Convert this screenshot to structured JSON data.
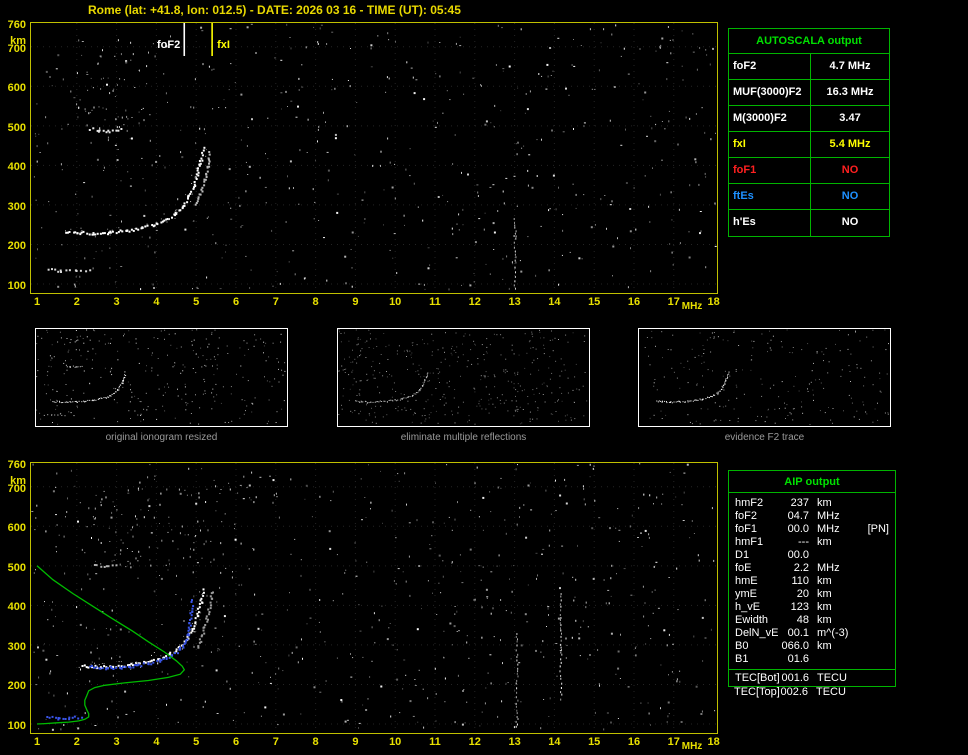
{
  "header": {
    "title": "Rome (lat: +41.8, lon: 012.5) - DATE: 2026 03 16 - TIME (UT): 05:45"
  },
  "autoscala": {
    "title": "AUTOSCALA output",
    "rows": [
      {
        "label": "foF2",
        "value": "4.7 MHz",
        "color": "#ffffff"
      },
      {
        "label": "MUF(3000)F2",
        "value": "16.3 MHz",
        "color": "#ffffff"
      },
      {
        "label": "M(3000)F2",
        "value": "3.47",
        "color": "#ffffff"
      },
      {
        "label": "fxI",
        "value": "5.4 MHz",
        "color": "#ffff00"
      },
      {
        "label": "foF1",
        "value": "NO",
        "color": "#ff2020"
      },
      {
        "label": "ftEs",
        "value": "NO",
        "color": "#1e90ff"
      },
      {
        "label": "h'Es",
        "value": "NO",
        "color": "#ffffff"
      }
    ]
  },
  "thumbnails": [
    {
      "caption": "original ionogram resized"
    },
    {
      "caption": "eliminate multiple reflections"
    },
    {
      "caption": "evidence F2 trace"
    }
  ],
  "aip": {
    "title": "AIP output",
    "rows": [
      {
        "label": "hmF2",
        "value": "237",
        "unit": "km",
        "extra": ""
      },
      {
        "label": "foF2",
        "value": "04.7",
        "unit": "MHz",
        "extra": ""
      },
      {
        "label": "foF1",
        "value": "00.0",
        "unit": "MHz",
        "extra": "[PN]"
      },
      {
        "label": "hmF1",
        "value": "---",
        "unit": "km",
        "extra": ""
      },
      {
        "label": "D1",
        "value": "00.0",
        "unit": "",
        "extra": ""
      },
      {
        "label": "foE",
        "value": "2.2",
        "unit": "MHz",
        "extra": ""
      },
      {
        "label": "hmE",
        "value": "110",
        "unit": "km",
        "extra": ""
      },
      {
        "label": "ymE",
        "value": "20",
        "unit": "km",
        "extra": ""
      },
      {
        "label": "h_vE",
        "value": "123",
        "unit": "km",
        "extra": ""
      },
      {
        "label": "Ewidth",
        "value": "48",
        "unit": "km",
        "extra": ""
      },
      {
        "label": "DelN_vE",
        "value": "00.1",
        "unit": "m^(-3)",
        "extra": ""
      },
      {
        "label": "B0",
        "value": "066.0",
        "unit": "km",
        "extra": ""
      },
      {
        "label": "B1",
        "value": "01.6",
        "unit": "",
        "extra": ""
      }
    ],
    "tec_rows": [
      {
        "label": "TEC[Bot]",
        "value": "001.6",
        "unit": "TECU"
      },
      {
        "label": "TEC[Top]",
        "value": "002.6",
        "unit": "TECU"
      }
    ]
  },
  "chart_data": [
    {
      "type": "scatter",
      "name": "ionogram-autoscala",
      "title": "measured ionogram with AUTOSCALA frequency markers",
      "xlabel": "MHz",
      "ylabel": "km",
      "xlim": [
        1,
        18
      ],
      "ylim": [
        60,
        760
      ],
      "x_ticks": [
        1,
        2,
        3,
        4,
        5,
        6,
        7,
        8,
        9,
        10,
        11,
        12,
        13,
        14,
        15,
        16,
        17,
        18
      ],
      "y_ticks": [
        760,
        700,
        600,
        500,
        400,
        300,
        200,
        100
      ],
      "grid": true,
      "markers": [
        {
          "label": "foF2",
          "freq_mhz": 4.7,
          "color": "#ffffff",
          "label_side": "left"
        },
        {
          "label": "fxI",
          "freq_mhz": 5.4,
          "color": "#ffff00",
          "label_side": "right"
        }
      ],
      "series": [
        {
          "name": "F2-trace",
          "color": "#ffffff",
          "halo": true,
          "points": [
            [
              1.7,
              235
            ],
            [
              2.0,
              232
            ],
            [
              2.4,
              230
            ],
            [
              2.8,
              232
            ],
            [
              3.2,
              236
            ],
            [
              3.6,
              243
            ],
            [
              3.9,
              252
            ],
            [
              4.2,
              263
            ],
            [
              4.45,
              278
            ],
            [
              4.65,
              298
            ],
            [
              4.8,
              322
            ],
            [
              4.92,
              350
            ],
            [
              5.02,
              382
            ],
            [
              5.1,
              415
            ],
            [
              5.15,
              445
            ]
          ]
        },
        {
          "name": "X-mode-trace",
          "color": "#b8b8b8",
          "points": [
            [
              4.95,
              300
            ],
            [
              5.08,
              330
            ],
            [
              5.2,
              365
            ],
            [
              5.28,
              400
            ],
            [
              5.33,
              435
            ]
          ]
        },
        {
          "name": "second-hop-echo",
          "color": "#e8e8e8",
          "size": 2,
          "step": 3,
          "points": [
            [
              2.3,
              495
            ],
            [
              2.55,
              490
            ],
            [
              2.8,
              488
            ],
            [
              3.1,
              494
            ]
          ]
        },
        {
          "name": "Es-trace",
          "color": "#d8d8d8",
          "size": 2,
          "step": 4,
          "points": [
            [
              1.25,
              138
            ],
            [
              1.6,
              134
            ],
            [
              1.95,
              136
            ],
            [
              2.3,
              135
            ]
          ]
        }
      ]
    },
    {
      "type": "scatter",
      "name": "ionogram-aip",
      "title": "ionogram with autoscaled trace and electron density profile",
      "xlabel": "MHz",
      "ylabel": "km",
      "xlim": [
        1,
        18
      ],
      "ylim": [
        60,
        760
      ],
      "x_ticks": [
        1,
        2,
        3,
        4,
        5,
        6,
        7,
        8,
        9,
        10,
        11,
        12,
        13,
        14,
        15,
        16,
        17,
        18
      ],
      "y_ticks": [
        760,
        700,
        600,
        500,
        400,
        300,
        200,
        100
      ],
      "grid": true,
      "markers": [],
      "series": [
        {
          "name": "F2-trace",
          "color": "#ffffff",
          "halo": true,
          "points": [
            [
              2.1,
              250
            ],
            [
              2.5,
              246
            ],
            [
              2.9,
              247
            ],
            [
              3.3,
              251
            ],
            [
              3.7,
              258
            ],
            [
              4.0,
              266
            ],
            [
              4.3,
              278
            ],
            [
              4.55,
              295
            ],
            [
              4.75,
              318
            ],
            [
              4.9,
              345
            ],
            [
              5.0,
              375
            ],
            [
              5.1,
              410
            ],
            [
              5.17,
              440
            ]
          ]
        },
        {
          "name": "X-mode-trace",
          "color": "#9a9a9a",
          "points": [
            [
              5.0,
              295
            ],
            [
              5.15,
              330
            ],
            [
              5.25,
              368
            ],
            [
              5.33,
              405
            ],
            [
              5.38,
              438
            ]
          ]
        },
        {
          "name": "second-hop-echo",
          "color": "#b0b0b0",
          "size": 2,
          "step": 4,
          "points": [
            [
              2.4,
              505
            ],
            [
              2.7,
              500
            ],
            [
              3.0,
              507
            ]
          ]
        },
        {
          "name": "autoscaled-F2-trace",
          "color": "#3a55e8",
          "size": 2,
          "points": [
            [
              2.3,
              248
            ],
            [
              2.7,
              244
            ],
            [
              3.1,
              245
            ],
            [
              3.5,
              249
            ],
            [
              3.8,
              255
            ],
            [
              4.1,
              262
            ],
            [
              4.35,
              273
            ],
            [
              4.55,
              288
            ],
            [
              4.7,
              306
            ],
            [
              4.78,
              330
            ],
            [
              4.83,
              358
            ],
            [
              4.86,
              388
            ],
            [
              4.88,
              415
            ]
          ]
        },
        {
          "name": "autoscaled-Es-trace",
          "color": "#3a55e8",
          "size": 2,
          "step": 3,
          "points": [
            [
              1.2,
              120
            ],
            [
              1.5,
              117
            ],
            [
              1.8,
              118
            ],
            [
              2.1,
              120
            ]
          ]
        },
        {
          "name": "electron-density-profile",
          "color": "#00bb00",
          "render": "line",
          "points": [
            [
              1.0,
              500
            ],
            [
              1.4,
              465
            ],
            [
              1.9,
              430
            ],
            [
              2.4,
              398
            ],
            [
              2.9,
              366
            ],
            [
              3.4,
              335
            ],
            [
              3.8,
              308
            ],
            [
              4.2,
              282
            ],
            [
              4.5,
              260
            ],
            [
              4.65,
              246
            ],
            [
              4.7,
              237
            ],
            [
              4.6,
              226
            ],
            [
              4.3,
              218
            ],
            [
              3.8,
              210
            ],
            [
              3.2,
              204
            ],
            [
              2.7,
              198
            ],
            [
              2.45,
              192
            ],
            [
              2.3,
              184
            ],
            [
              2.25,
              172
            ],
            [
              2.2,
              160
            ],
            [
              2.2,
              148
            ],
            [
              2.25,
              136
            ],
            [
              2.3,
              126
            ],
            [
              2.3,
              118
            ],
            [
              2.2,
              112
            ],
            [
              2.05,
              108
            ],
            [
              1.8,
              105
            ],
            [
              1.5,
              103
            ],
            [
              1.2,
              101
            ],
            [
              1.0,
              100
            ]
          ]
        }
      ]
    }
  ]
}
